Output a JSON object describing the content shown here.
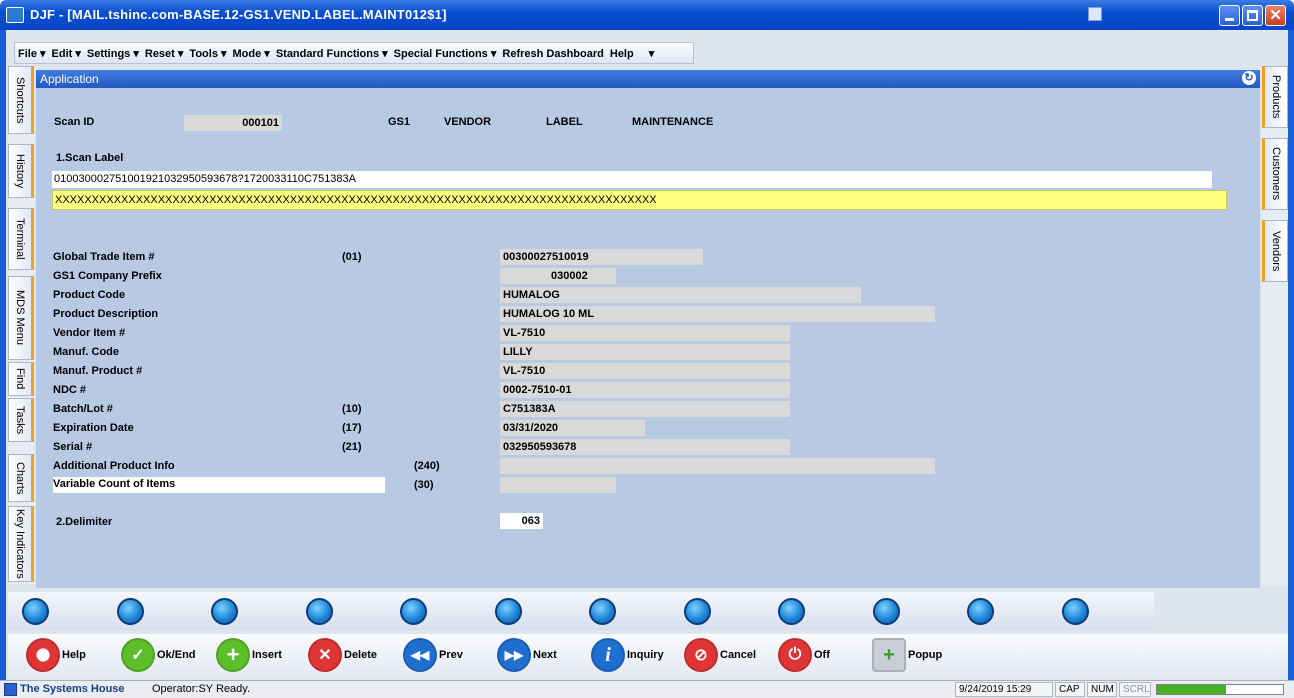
{
  "window": {
    "title": "DJF - [MAIL.tshinc.com-BASE.12-GS1.VEND.LABEL.MAINT012$1]"
  },
  "menu": [
    "File ▾",
    "Edit ▾",
    "Settings ▾",
    "Reset ▾",
    "Tools ▾",
    "Mode ▾",
    "Standard Functions ▾",
    "Special Functions ▾",
    "Refresh Dashboard",
    "Help",
    "▾"
  ],
  "left_tabs": [
    "Shortcuts",
    "History",
    "Terminal",
    "MDS Menu",
    "Find",
    "Tasks",
    "Charts",
    "Key Indicators"
  ],
  "right_tabs": [
    "Products",
    "Customers",
    "Vendors"
  ],
  "app": {
    "header": "Application"
  },
  "form": {
    "scan_id_label": "Scan ID",
    "scan_id_value": "000101",
    "heading": [
      "GS1",
      "VENDOR",
      "LABEL",
      "MAINTENANCE"
    ],
    "scan_label_caption": "1.Scan Label",
    "scan_label_value": "010030002751001921032950593678?1720033110C751383A",
    "scan_check": "XXXXXXXXXXXXXXXXXXXXXXXXXXXXXXXXXXXXXXXXXXXXXXXXXXXXXXXXXXXXXXXXXXXXXXXXXXXXXXXXXX",
    "rows": [
      {
        "label": "Global Trade Item #",
        "ai": "(01)",
        "value": "00300027510019"
      },
      {
        "label": "GS1 Company Prefix",
        "ai": "",
        "value": "030002"
      },
      {
        "label": "Product Code",
        "ai": "",
        "value": "HUMALOG"
      },
      {
        "label": "Product Description",
        "ai": "",
        "value": "HUMALOG 10 ML"
      },
      {
        "label": "Vendor Item #",
        "ai": "",
        "value": "VL-7510"
      },
      {
        "label": "Manuf. Code",
        "ai": "",
        "value": "LILLY"
      },
      {
        "label": "Manuf. Product #",
        "ai": "",
        "value": "VL-7510"
      },
      {
        "label": "NDC #",
        "ai": "",
        "value": "0002-7510-01"
      },
      {
        "label": "Batch/Lot #",
        "ai": "(10)",
        "value": "C751383A"
      },
      {
        "label": "Expiration Date",
        "ai": "(17)",
        "value": "03/31/2020"
      },
      {
        "label": "Serial #",
        "ai": "(21)",
        "value": "032950593678"
      },
      {
        "label": "Additional Product Info",
        "ai": "(240)",
        "value": ""
      },
      {
        "label": "Variable Count of Items",
        "ai": "(30)",
        "value": ""
      }
    ],
    "delimiter_caption": "2.Delimiter",
    "delimiter_value": "063"
  },
  "actions": [
    "Help",
    "Ok/End",
    "Insert",
    "Delete",
    "Prev",
    "Next",
    "Inquiry",
    "Cancel",
    "Off",
    "Popup"
  ],
  "status": {
    "company": "The Systems House",
    "message": "Operator:SY Ready.",
    "datetime": "9/24/2019 15:29",
    "cap": "CAP",
    "num": "NUM",
    "scrl": "SCRL"
  }
}
